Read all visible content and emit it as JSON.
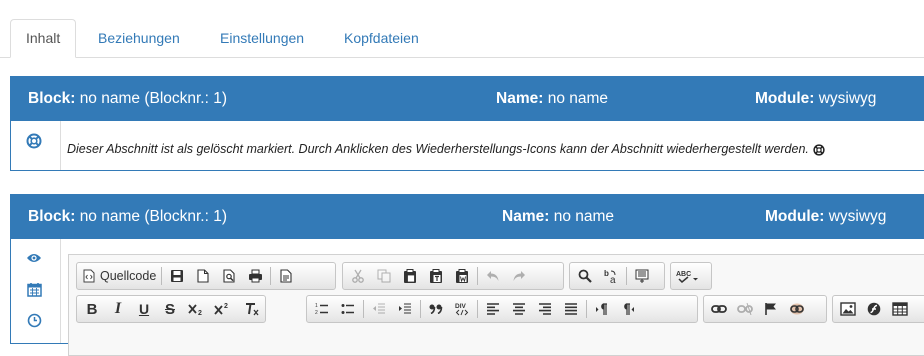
{
  "tabs": [
    {
      "label": "Inhalt",
      "active": true
    },
    {
      "label": "Beziehungen",
      "active": false
    },
    {
      "label": "Einstellungen",
      "active": false
    },
    {
      "label": "Kopfdateien",
      "active": false
    }
  ],
  "block1": {
    "block_label": "Block:",
    "block_value": "no name (Blocknr.: 1)",
    "name_label": "Name:",
    "name_value": "no name",
    "module_label": "Module:",
    "module_value": "wysiwyg",
    "side_icons": [
      "restore-lifebuoy-icon"
    ],
    "message": "Dieser Abschnitt ist als gelöscht markiert. Durch Anklicken des Wiederherstellungs-Icons kann der Abschnitt wiederhergestellt werden."
  },
  "block2": {
    "block_label": "Block:",
    "block_value": "no name (Blocknr.: 1)",
    "name_label": "Name:",
    "name_value": "no name",
    "module_label": "Module:",
    "module_value": "wysiwyg",
    "side_icons": [
      "eye-icon",
      "calendar-icon",
      "clock-icon"
    ]
  },
  "editor": {
    "source_label": "Quellcode",
    "toolbar_row1": [
      "source-icon",
      "save-icon",
      "new-page-icon",
      "preview-icon",
      "print-icon",
      "templates-icon",
      "cut-icon",
      "copy-icon",
      "paste-icon",
      "paste-text-icon",
      "paste-word-icon",
      "undo-icon",
      "redo-icon",
      "find-icon",
      "replace-icon",
      "select-all-icon",
      "spellcheck-icon"
    ],
    "toolbar_row2": [
      "bold-icon",
      "italic-icon",
      "underline-icon",
      "strike-icon",
      "subscript-icon",
      "superscript-icon",
      "remove-format-icon",
      "numbered-list-icon",
      "bulleted-list-icon",
      "outdent-icon",
      "indent-icon",
      "blockquote-icon",
      "div-icon",
      "align-left-icon",
      "align-center-icon",
      "align-right-icon",
      "justify-icon",
      "ltr-icon",
      "rtl-icon",
      "link-icon",
      "unlink-icon",
      "anchor-icon",
      "droplet-link-icon",
      "image-icon",
      "flash-icon",
      "table-icon"
    ]
  },
  "colors": {
    "primary": "#337ab7",
    "tab_border": "#dddddd",
    "toolbar_border": "#c6c6c6"
  }
}
